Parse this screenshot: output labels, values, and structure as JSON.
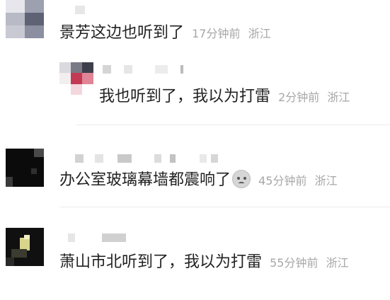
{
  "comments": [
    {
      "text": "景芳这边也听到了",
      "time": "17分钟前",
      "location": "浙江"
    },
    {
      "text": "我也听到了，我以为打雷",
      "time": "2分钟前",
      "location": "浙江"
    },
    {
      "text": "办公室玻璃幕墙都震响了",
      "emoji": "crying-face-icon",
      "time": "45分钟前",
      "location": "浙江"
    },
    {
      "text": "萧山市北听到了，我以为打雷",
      "time": "55分钟前",
      "location": "浙江"
    }
  ],
  "colors": {
    "text": "#222222",
    "meta": "#a7a7a7",
    "divider": "#ececec",
    "background": "#ffffff"
  }
}
